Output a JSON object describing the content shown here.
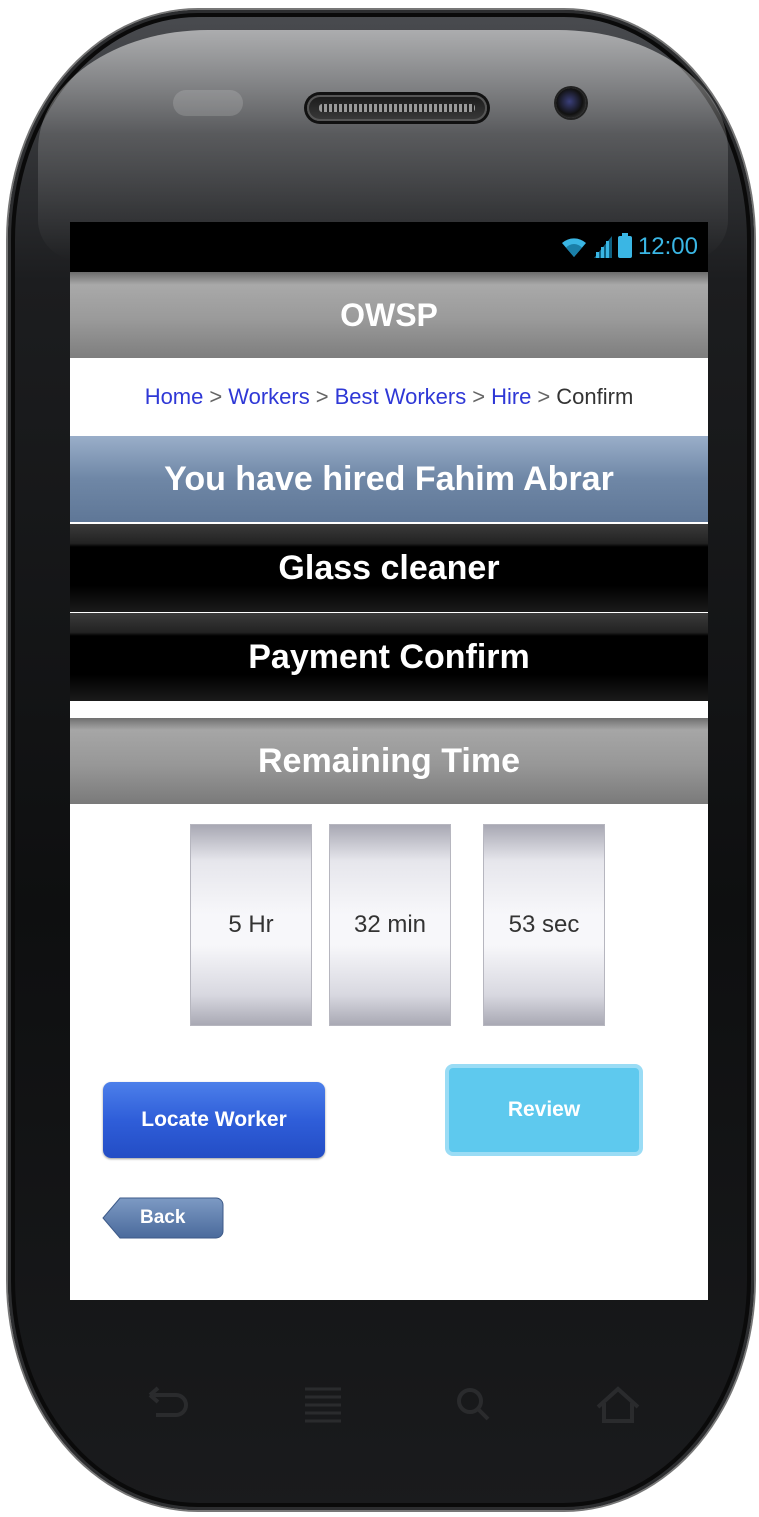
{
  "status": {
    "time": "12:00"
  },
  "app": {
    "title": "OWSP"
  },
  "breadcrumb": {
    "items": [
      {
        "label": "Home",
        "link": true
      },
      {
        "label": "Workers",
        "link": true
      },
      {
        "label": "Best Workers",
        "link": true
      },
      {
        "label": "Hire",
        "link": true
      },
      {
        "label": "Confirm",
        "link": false
      }
    ],
    "separator": ">"
  },
  "confirmation": {
    "hired_text": "You have hired Fahim Abrar",
    "job": "Glass cleaner",
    "payment": "Payment Confirm"
  },
  "timer": {
    "heading": "Remaining Time",
    "hours": "5 Hr",
    "minutes": "32 min",
    "seconds": "53 sec"
  },
  "buttons": {
    "locate": "Locate Worker",
    "review": "Review",
    "back": "Back"
  },
  "colors": {
    "link": "#2f38d6",
    "status_accent": "#3ab6e4",
    "locate_button": "#2f5ed9",
    "review_button": "#5ec9ee"
  }
}
